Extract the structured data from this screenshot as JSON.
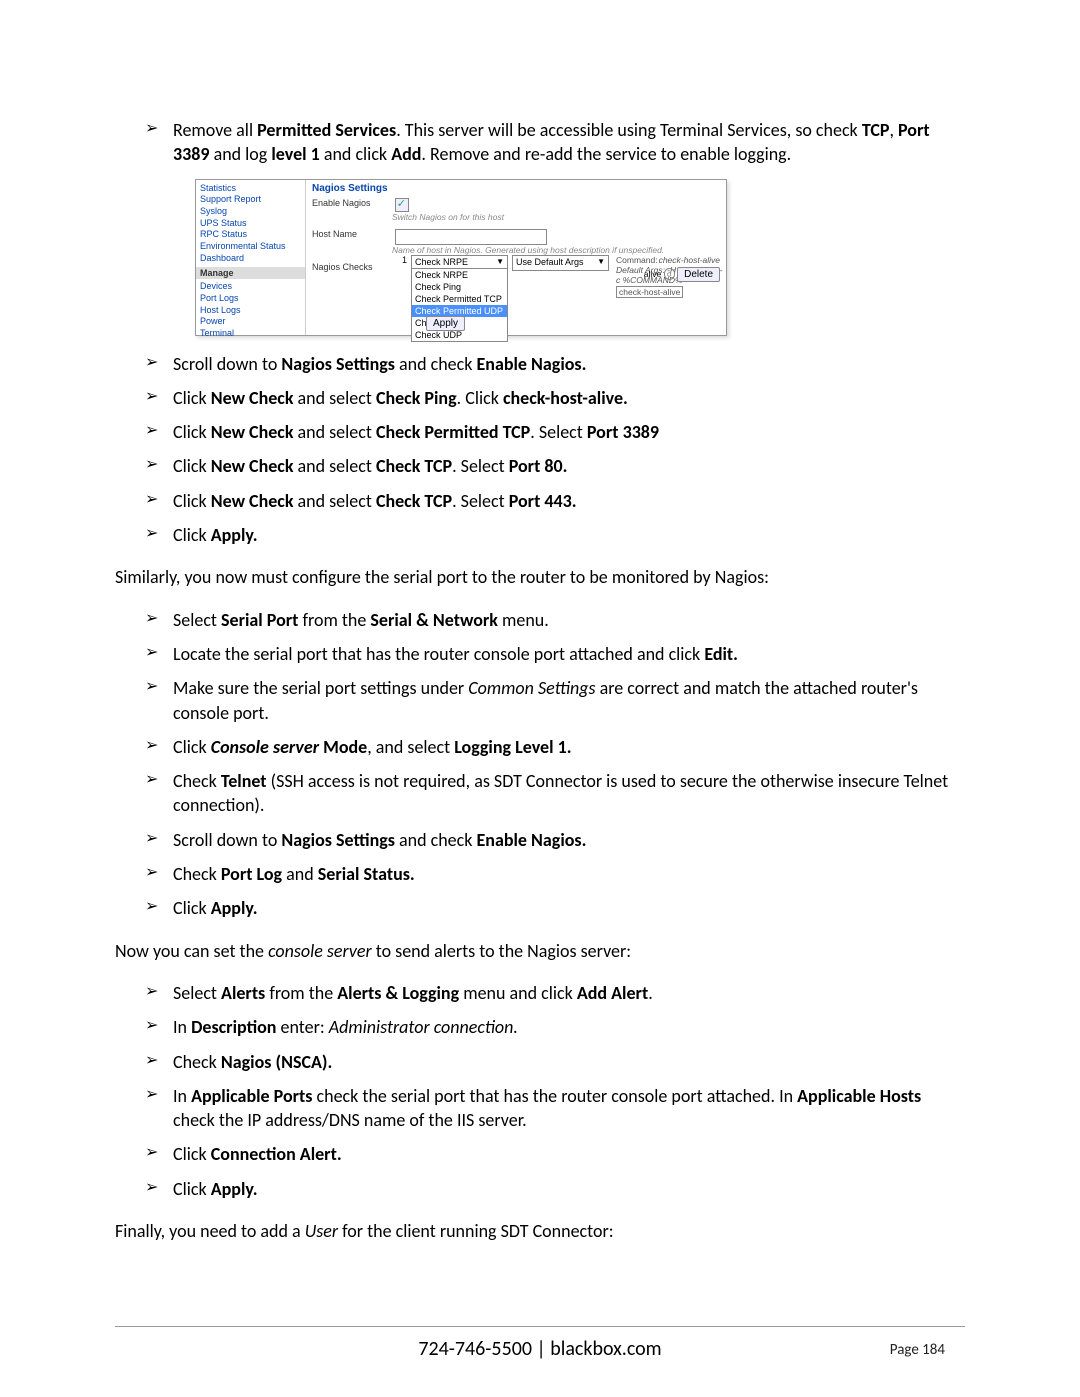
{
  "intro_items": [
    [
      {
        "t": "Remove all "
      },
      {
        "t": "Permitted Services",
        "b": true
      },
      {
        "t": ". This server will be accessible using Terminal Services, so check "
      },
      {
        "t": "TCP",
        "b": true
      },
      {
        "t": ", "
      },
      {
        "t": "Port 3389",
        "b": true
      },
      {
        "t": " and log "
      },
      {
        "t": "level 1",
        "b": true
      },
      {
        "t": " and click "
      },
      {
        "t": "Add",
        "b": true
      },
      {
        "t": ". Remove and re-add the service to enable logging."
      }
    ]
  ],
  "shot": {
    "nav1": [
      "Statistics",
      "Support Report",
      "Syslog",
      "UPS Status",
      "RPC Status",
      "Environmental Status",
      "Dashboard"
    ],
    "manage_label": "Manage",
    "nav2": [
      "Devices",
      "Port Logs",
      "Host Logs",
      "Power",
      "Terminal"
    ],
    "heading": "Nagios Settings",
    "enable_label": "Enable Nagios",
    "enable_help": "Switch Nagios on for this host",
    "hostname_label": "Host Name",
    "hostname_help": "Name of host in Nagios. Generated using host description if unspecified.",
    "checks_label": "Nagios Checks",
    "dd_selected": "Check NRPE",
    "dd_options": [
      "Check NRPE",
      "Check Ping",
      "Check Permitted TCP",
      "Check Permitted UDP",
      "Check TCP",
      "Check UDP"
    ],
    "dd_highlight_index": 3,
    "use_default": "Use Default Args",
    "command_label": "Command:",
    "default_args": "Default Args: -H %HOST% -c %COMMAND%",
    "check_host": "check-host-alive",
    "right_small": "check-host-alive",
    "delete": "Delete",
    "apply": "Apply"
  },
  "after_shot_items": [
    [
      {
        "t": "Scroll down to "
      },
      {
        "t": "Nagios Settings",
        "b": true
      },
      {
        "t": " and check "
      },
      {
        "t": "Enable Nagios.",
        "b": true
      }
    ],
    [
      {
        "t": "Click "
      },
      {
        "t": "New Check",
        "b": true
      },
      {
        "t": " and select "
      },
      {
        "t": "Check Ping",
        "b": true
      },
      {
        "t": ". Click "
      },
      {
        "t": "check-host-alive.",
        "b": true
      }
    ],
    [
      {
        "t": "Click "
      },
      {
        "t": "New Check",
        "b": true
      },
      {
        "t": " and select "
      },
      {
        "t": "Check Permitted TCP",
        "b": true
      },
      {
        "t": ". Select "
      },
      {
        "t": "Port 3389",
        "b": true
      }
    ],
    [
      {
        "t": "Click "
      },
      {
        "t": "New Check",
        "b": true
      },
      {
        "t": " and select "
      },
      {
        "t": "Check TCP",
        "b": true
      },
      {
        "t": ". Select "
      },
      {
        "t": "Port 80.",
        "b": true
      }
    ],
    [
      {
        "t": "Click "
      },
      {
        "t": "New Check",
        "b": true
      },
      {
        "t": " and select "
      },
      {
        "t": "Check TCP",
        "b": true
      },
      {
        "t": ". Select "
      },
      {
        "t": "Port 443.",
        "b": true
      }
    ],
    [
      {
        "t": "Click "
      },
      {
        "t": "Apply.",
        "b": true
      }
    ]
  ],
  "para1": "Similarly, you now must configure the serial port to the router to be monitored by Nagios:",
  "serial_items": [
    [
      {
        "t": "Select "
      },
      {
        "t": "Serial Port",
        "b": true
      },
      {
        "t": " from the "
      },
      {
        "t": "Serial & Network",
        "b": true
      },
      {
        "t": " menu."
      }
    ],
    [
      {
        "t": "Locate the serial port that has the router console port attached and click "
      },
      {
        "t": "Edit.",
        "b": true
      }
    ],
    [
      {
        "t": "Make sure the serial port settings under "
      },
      {
        "t": "Common Settings",
        "i": true
      },
      {
        "t": " are correct and match the attached router's console port."
      }
    ],
    [
      {
        "t": "Click "
      },
      {
        "t": "Console server",
        "b": true,
        "i": true
      },
      {
        "t": " Mode",
        "b": true
      },
      {
        "t": ", and select "
      },
      {
        "t": "Logging Level 1.",
        "b": true
      }
    ],
    [
      {
        "t": "Check "
      },
      {
        "t": "Telnet",
        "b": true
      },
      {
        "t": " (SSH access is not required, as SDT Connector is used to secure the otherwise insecure Telnet connection)."
      }
    ],
    [
      {
        "t": "Scroll down to "
      },
      {
        "t": "Nagios Settings",
        "b": true
      },
      {
        "t": " and check "
      },
      {
        "t": "Enable Nagios.",
        "b": true
      }
    ],
    [
      {
        "t": "Check "
      },
      {
        "t": "Port Log",
        "b": true
      },
      {
        "t": " and "
      },
      {
        "t": "Serial Status.",
        "b": true
      }
    ],
    [
      {
        "t": "Click "
      },
      {
        "t": "Apply.",
        "b": true
      }
    ]
  ],
  "para2_parts": [
    {
      "t": "Now you can set the "
    },
    {
      "t": "console server",
      "i": true
    },
    {
      "t": " to send alerts to the Nagios server:"
    }
  ],
  "alerts_items": [
    [
      {
        "t": "Select "
      },
      {
        "t": "Alerts",
        "b": true
      },
      {
        "t": " from the "
      },
      {
        "t": "Alerts & Logging",
        "b": true
      },
      {
        "t": " menu and click "
      },
      {
        "t": "Add Alert",
        "b": true
      },
      {
        "t": "."
      }
    ],
    [
      {
        "t": "In "
      },
      {
        "t": "Description",
        "b": true
      },
      {
        "t": " enter: "
      },
      {
        "t": "Administrator connection.",
        "i": true
      }
    ],
    [
      {
        "t": "Check "
      },
      {
        "t": "Nagios (NSCA).",
        "b": true
      }
    ],
    [
      {
        "t": "In "
      },
      {
        "t": "Applicable Ports",
        "b": true
      },
      {
        "t": " check the serial port that has the router console port attached.  In "
      },
      {
        "t": "Applicable Hosts",
        "b": true
      },
      {
        "t": " check the IP address/DNS name of the IIS server."
      }
    ],
    [
      {
        "t": "Click "
      },
      {
        "t": "Connection Alert.",
        "b": true
      }
    ],
    [
      {
        "t": "Click "
      },
      {
        "t": "Apply.",
        "b": true
      }
    ]
  ],
  "para3_parts": [
    {
      "t": "Finally, you need to add a "
    },
    {
      "t": "User",
      "i": true
    },
    {
      "t": " for the client running SDT Connector:"
    }
  ],
  "footer": "724-746-5500 | blackbox.com",
  "page_num": "Page 184"
}
